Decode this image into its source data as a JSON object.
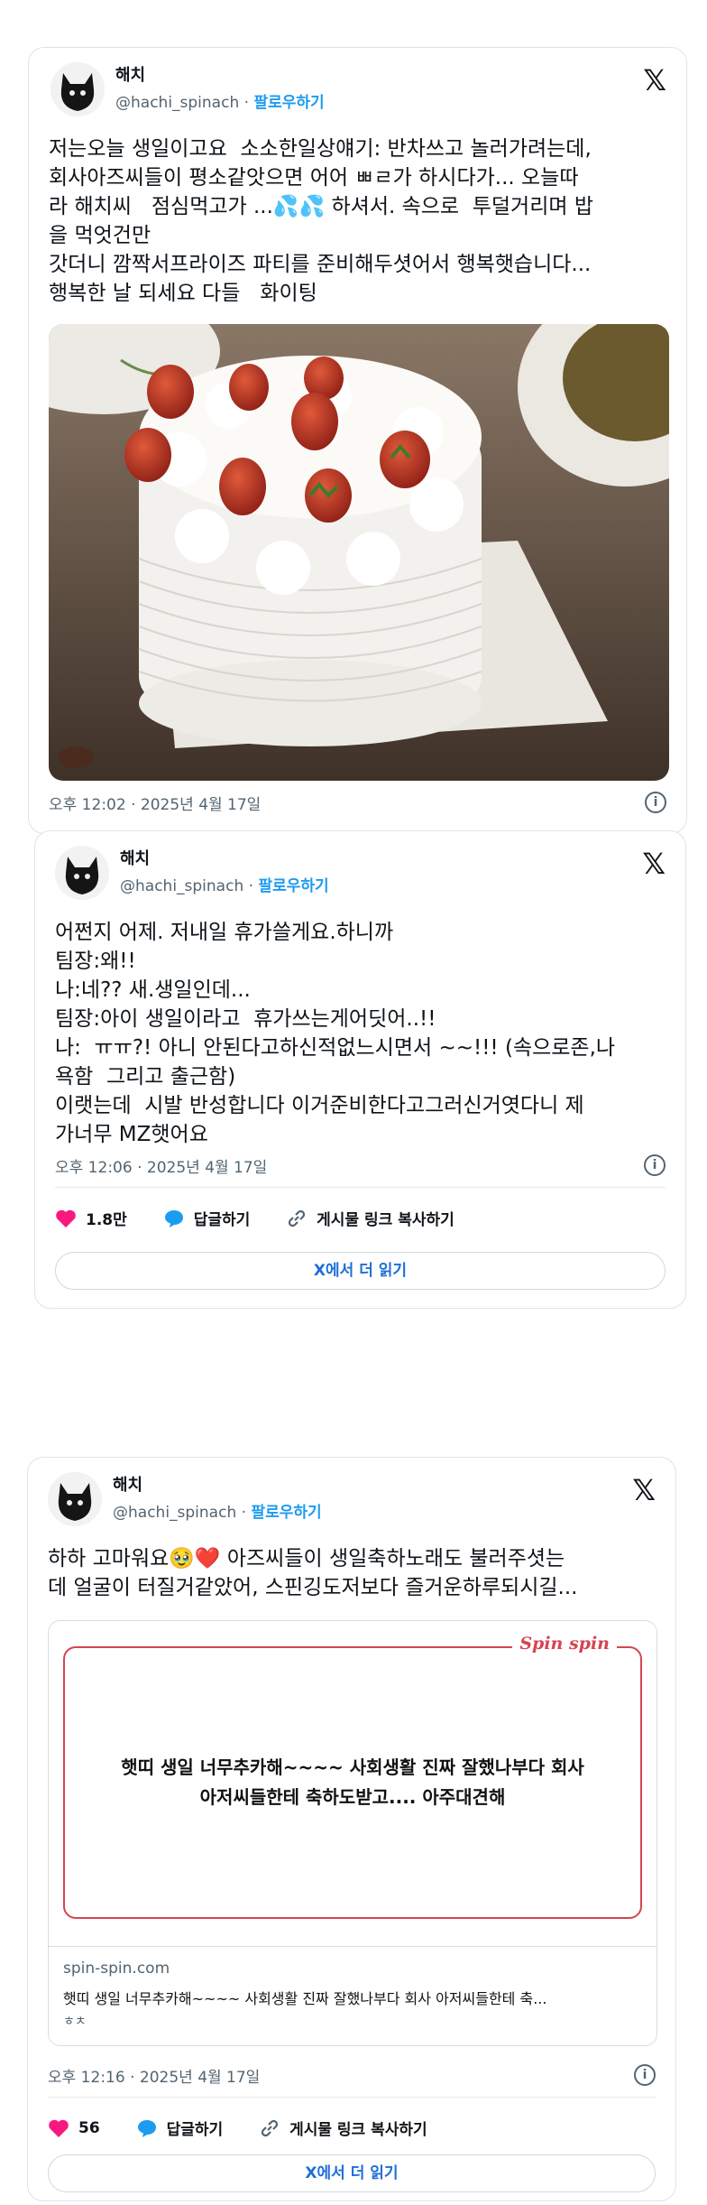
{
  "tweets": [
    {
      "author_name": "해치",
      "handle": "@hachi_spinach",
      "separator": " · ",
      "follow_label": "팔로우하기",
      "text": "저는오늘 생일이고요  소소한일상얘기: 반차쓰고 놀러가려는데,\n회사아즈씨들이 평소같앗으면 어어 ㅃㄹ가 하시다가... 오늘따\n라 해치씨   점심먹고가 ...💦💦 하셔서. 속으로  투덜거리며 밥\n을 먹엇건만\n갓더니 깜짝서프라이즈 파티를 준비해두셧어서 행복햇습니다...\n행복한 날 되세요 다들   화이팅",
      "timestamp": "오후 12:02 · 2025년 4월 17일"
    },
    {
      "author_name": "해치",
      "handle": "@hachi_spinach",
      "separator": " · ",
      "follow_label": "팔로우하기",
      "text": "어쩐지 어제. 저내일 휴가쓸게요.하니까\n팀장:왜!!\n나:네?? 새.생일인데...\n팀장:아이 생일이라고  휴가쓰는게어딧어..!!\n나:  ㅠㅠ?! 아니 안된다고하신적없느시면서 ~~!!! (속으로존,나\n욕함  그리고 출근함)\n이랫는데  시발 반성합니다 이거준비한다고그러신거엿다니 제\n가너무 MZ햇어요",
      "timestamp": "오후 12:06 · 2025년 4월 17일",
      "likes": "1.8만",
      "reply_label": "답글하기",
      "copy_label": "게시물 링크 복사하기",
      "read_more": "X에서 더 읽기"
    },
    {
      "author_name": "해치",
      "handle": "@hachi_spinach",
      "separator": " · ",
      "follow_label": "팔로우하기",
      "text": "하하 고마워요🥹❤️ 아즈씨들이 생일축하노래도 불러주셧는\n데 얼굴이 터질거같았어, 스핀깅도저보다 즐거운하루되시길...",
      "timestamp": "오후 12:16 · 2025년 4월 17일",
      "likes": "56",
      "reply_label": "답글하기",
      "copy_label": "게시물 링크 복사하기",
      "read_more": "X에서 더 읽기",
      "link_card": {
        "logo": "Spin spin",
        "image_text": "햇띠 생일 너무추카해~~~~ 사회생활 진짜 잘했나부다 회사\n아저씨들한테 축하도받고.... 아주대견해",
        "domain": "spin-spin.com",
        "title": "햇띠 생일 너무추카해~~~~ 사회생활 진짜 잘했나부다 회사 아저씨들한테 축...",
        "desc": "ㅎㅊ"
      }
    }
  ],
  "icons": {
    "x_logo": "𝕏",
    "info": "i",
    "heart_color": "#f91880",
    "reply_color": "#1d9bf0",
    "link_color": "#1d6fd6",
    "spin_red": "#d64452"
  }
}
